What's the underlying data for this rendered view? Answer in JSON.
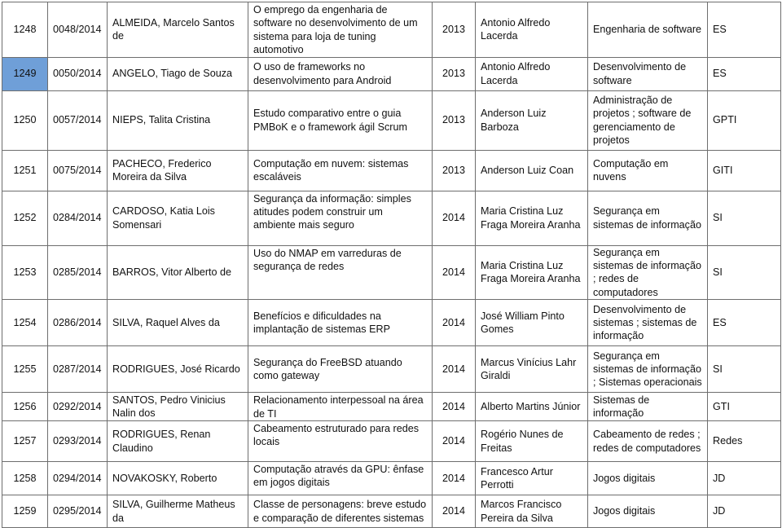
{
  "highlight_color": "#6f9fd8",
  "rows": [
    [
      "1248",
      "0048/2014",
      "ALMEIDA, Marcelo Santos de",
      "O emprego da engenharia de software no desenvolvimento de um sistema para loja de tuning automotivo",
      "2013",
      "Antonio Alfredo Lacerda",
      "Engenharia de software",
      "ES"
    ],
    [
      "1249",
      "0050/2014",
      "ANGELO, Tiago de Souza",
      "O uso de frameworks no desenvolvimento para Android",
      "2013",
      "Antonio Alfredo Lacerda",
      "Desenvolvimento de software",
      "ES"
    ],
    [
      "1250",
      "0057/2014",
      "NIEPS, Talita Cristina",
      "Estudo comparativo entre o guia PMBoK e o framework ágil Scrum",
      "2013",
      "Anderson Luiz Barboza",
      "Administração de projetos ; software de gerenciamento de projetos",
      "GPTI"
    ],
    [
      "1251",
      "0075/2014",
      "PACHECO, Frederico Moreira da Silva",
      "Computação em nuvem: sistemas escaláveis",
      "2013",
      "Anderson Luiz Coan",
      "Computação em nuvens",
      "GITI"
    ],
    [
      "1252",
      "0284/2014",
      "CARDOSO, Katia Lois Somensari",
      "Segurança da informação: simples atitudes podem construir um ambiente mais seguro",
      "2014",
      "Maria Cristina Luz Fraga Moreira Aranha",
      "Segurança em sistemas de informação",
      "SI"
    ],
    [
      "1253",
      "0285/2014",
      "BARROS, Vitor Alberto de",
      "Uso do NMAP em varreduras de segurança de redes",
      "2014",
      "Maria Cristina Luz Fraga Moreira Aranha",
      "Segurança em sistemas de informação ; redes de computadores",
      "SI"
    ],
    [
      "1254",
      "0286/2014",
      "SILVA, Raquel Alves da",
      "Benefícios e dificuldades na implantação de sistemas ERP",
      "2014",
      "José William Pinto Gomes",
      "Desenvolvimento de sistemas ; sistemas de informação",
      "ES"
    ],
    [
      "1255",
      "0287/2014",
      "RODRIGUES, José Ricardo",
      "Segurança do FreeBSD atuando como gateway",
      "2014",
      "Marcus Vinícius Lahr Giraldi",
      "Segurança em sistemas de informação ; Sistemas operacionais",
      "SI"
    ],
    [
      "1256",
      "0292/2014",
      "SANTOS, Pedro Vinicius Nalin dos",
      "Relacionamento interpessoal na área de TI",
      "2014",
      "Alberto Martins Júnior",
      "Sistemas de informação",
      "GTI"
    ],
    [
      "1257",
      "0293/2014",
      "RODRIGUES, Renan Claudino",
      "Cabeamento estruturado para redes locais",
      "2014",
      "Rogério Nunes de Freitas",
      "Cabeamento de redes ; redes de computadores",
      "Redes"
    ],
    [
      "1258",
      "0294/2014",
      "NOVAKOSKY, Roberto",
      "Computação através da GPU: ênfase em jogos digitais",
      "2014",
      "Francesco Artur Perrotti",
      "Jogos digitais",
      "JD"
    ],
    [
      "1259",
      "0295/2014",
      "SILVA, Guilherme Matheus da",
      "Classe de personagens:  breve estudo e comparação de diferentes sistemas",
      "2014",
      "Marcos Francisco Pereira da Silva",
      "Jogos digitais",
      "JD"
    ]
  ]
}
